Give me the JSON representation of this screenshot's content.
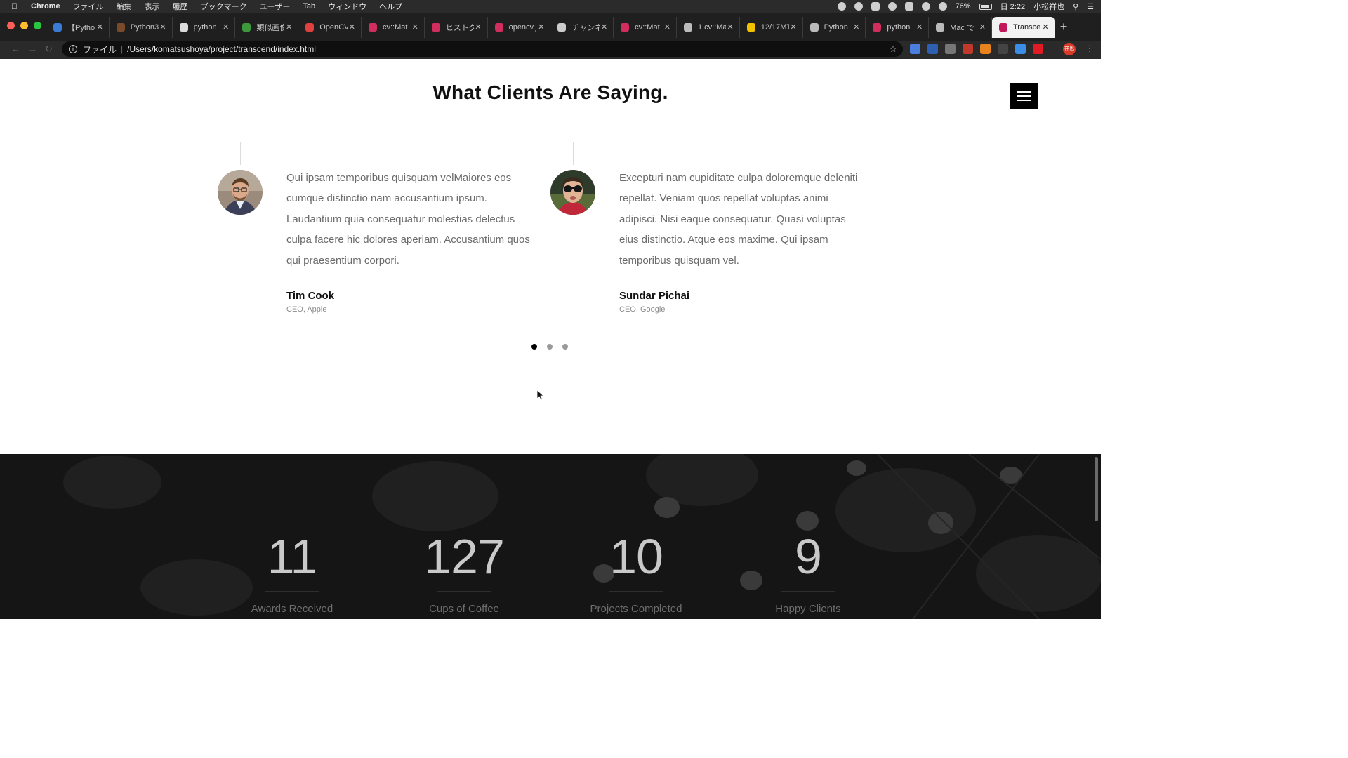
{
  "menubar": {
    "app_name": "Chrome",
    "items": [
      "ファイル",
      "編集",
      "表示",
      "履歴",
      "ブックマーク",
      "ユーザー",
      "Tab",
      "ウィンドウ",
      "ヘルプ"
    ],
    "battery": "76%",
    "clock": "日 2:22",
    "user": "小松祥也"
  },
  "browser": {
    "tabs": [
      {
        "label": "【Pytho",
        "color": "#3a7bd5",
        "active": false
      },
      {
        "label": "Python3",
        "color": "#7a4b2a",
        "active": false
      },
      {
        "label": "python",
        "color": "#dddddd",
        "active": false
      },
      {
        "label": "類似画像",
        "color": "#3c9a3c",
        "active": false
      },
      {
        "label": "OpenCV",
        "color": "#e04040",
        "active": false
      },
      {
        "label": "cv::Mat",
        "color": "#d12d5e",
        "active": false
      },
      {
        "label": "ヒストグ",
        "color": "#d12d5e",
        "active": false
      },
      {
        "label": "opencv.j",
        "color": "#d12d5e",
        "active": false
      },
      {
        "label": "チャンネ",
        "color": "#cccccc",
        "active": false
      },
      {
        "label": "cv::Mat",
        "color": "#d12d5e",
        "active": false
      },
      {
        "label": "1 cv::Ma",
        "color": "#bbbbbb",
        "active": false
      },
      {
        "label": "12/17MT",
        "color": "#f2c200",
        "active": false
      },
      {
        "label": "Python",
        "color": "#bbbbbb",
        "active": false
      },
      {
        "label": "python",
        "color": "#d12d5e",
        "active": false
      },
      {
        "label": "Mac で",
        "color": "#bbbbbb",
        "active": false
      },
      {
        "label": "Transce",
        "color": "#c2185b",
        "active": true
      }
    ],
    "scheme_label": "ファイル",
    "url": "/Users/komatsushoya/project/transcend/index.html",
    "profile_initials": "祥也"
  },
  "testimonials": {
    "title": "What Clients Are Saying.",
    "items": [
      {
        "text": "Qui ipsam temporibus quisquam velMaiores eos cumque distinctio nam accusantium ipsum. Laudantium quia consequatur molestias delectus culpa facere hic dolores aperiam. Accusantium quos qui praesentium corpori.",
        "name": "Tim Cook",
        "role": "CEO, Apple"
      },
      {
        "text": "Excepturi nam cupiditate culpa doloremque deleniti repellat. Veniam quos repellat voluptas animi adipisci. Nisi eaque consequatur. Quasi voluptas eius distinctio. Atque eos maxime. Qui ipsam temporibus quisquam vel.",
        "name": "Sundar Pichai",
        "role": "CEO, Google"
      }
    ],
    "slides": 3,
    "active_slide": 1
  },
  "stats": [
    {
      "value": "11",
      "label": "Awards Received"
    },
    {
      "value": "127",
      "label": "Cups of Coffee"
    },
    {
      "value": "10",
      "label": "Projects Completed"
    },
    {
      "value": "9",
      "label": "Happy Clients"
    }
  ],
  "icons": {
    "menu": "hamburger-menu-icon",
    "star": "bookmark-star-icon",
    "info": "info-icon",
    "close": "close-icon",
    "new_tab": "plus-icon",
    "cursor": "mouse-pointer-icon"
  }
}
